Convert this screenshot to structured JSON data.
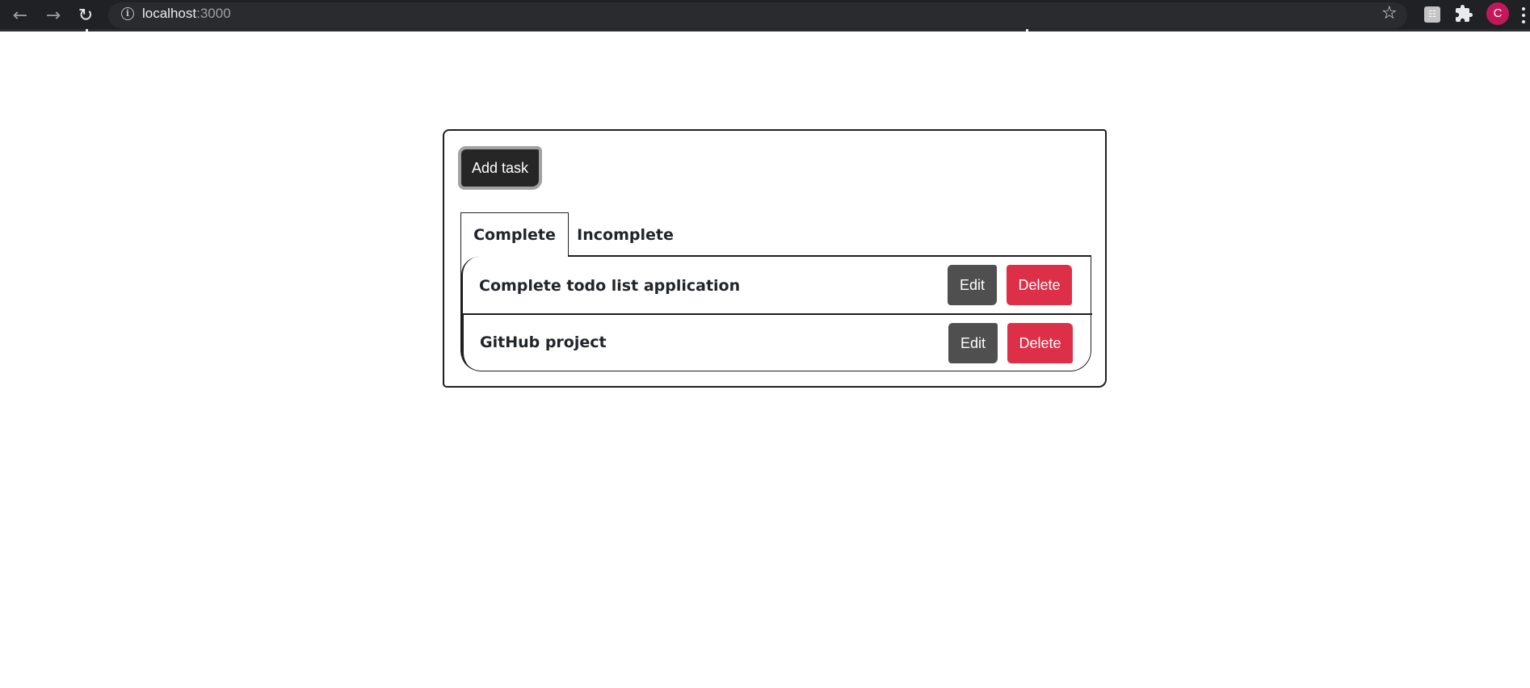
{
  "browser": {
    "url_host": "localhost",
    "url_port": ":3000",
    "avatar_letter": "C"
  },
  "app": {
    "add_task_label": "Add task",
    "tabs": [
      {
        "label": "Complete",
        "active": true
      },
      {
        "label": "Incomplete",
        "active": false
      }
    ],
    "tasks": [
      {
        "title": "Complete todo list application",
        "edit_label": "Edit",
        "delete_label": "Delete"
      },
      {
        "title": "GitHub project",
        "edit_label": "Edit",
        "delete_label": "Delete"
      }
    ]
  },
  "colors": {
    "add_button": "#262626",
    "edit_button": "#4f4f4f",
    "delete_button": "#de2f48",
    "avatar": "#c2185b"
  }
}
